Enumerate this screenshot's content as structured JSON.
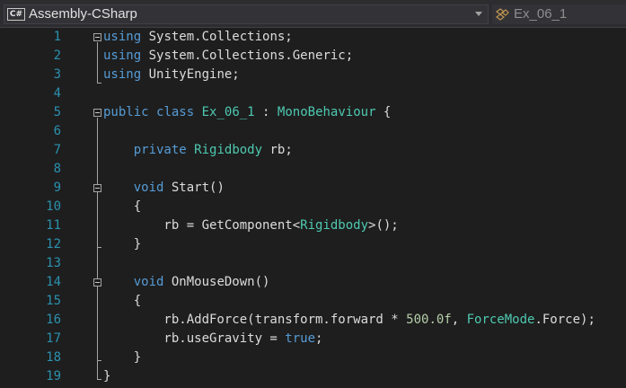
{
  "toolbar": {
    "project": "Assembly-CSharp",
    "project_icon": "C#",
    "member": "Ex_06_1",
    "member_icon": "class-icon"
  },
  "colors": {
    "background": "#1e1e1e",
    "line_number": "#2b91af",
    "keyword": "#569cd6",
    "type": "#4ec9b0",
    "number": "#b5cea8",
    "text": "#dcdcdc"
  },
  "lines": [
    {
      "n": "1",
      "tokens": [
        [
          "using",
          "kw"
        ],
        [
          " System.Collections;",
          ""
        ]
      ]
    },
    {
      "n": "2",
      "tokens": [
        [
          "using",
          "kw"
        ],
        [
          " System.Collections.Generic;",
          ""
        ]
      ]
    },
    {
      "n": "3",
      "tokens": [
        [
          "using",
          "kw"
        ],
        [
          " UnityEngine;",
          ""
        ]
      ]
    },
    {
      "n": "4",
      "tokens": []
    },
    {
      "n": "5",
      "tokens": [
        [
          "public",
          "kw"
        ],
        [
          " ",
          ""
        ],
        [
          "class",
          "kw"
        ],
        [
          " ",
          ""
        ],
        [
          "Ex_06_1",
          "ty"
        ],
        [
          " : ",
          ""
        ],
        [
          "MonoBehaviour",
          "ty"
        ],
        [
          " {",
          ""
        ]
      ]
    },
    {
      "n": "6",
      "tokens": []
    },
    {
      "n": "7",
      "tokens": [
        [
          "    ",
          ""
        ],
        [
          "private",
          "kw"
        ],
        [
          " ",
          ""
        ],
        [
          "Rigidbody",
          "ty"
        ],
        [
          " rb;",
          ""
        ]
      ]
    },
    {
      "n": "8",
      "tokens": []
    },
    {
      "n": "9",
      "tokens": [
        [
          "    ",
          ""
        ],
        [
          "void",
          "kw"
        ],
        [
          " Start()",
          ""
        ]
      ]
    },
    {
      "n": "10",
      "tokens": [
        [
          "    {",
          ""
        ]
      ]
    },
    {
      "n": "11",
      "tokens": [
        [
          "        rb = GetComponent<",
          ""
        ],
        [
          "Rigidbody",
          "ty"
        ],
        [
          ">();",
          ""
        ]
      ]
    },
    {
      "n": "12",
      "tokens": [
        [
          "    }",
          ""
        ]
      ]
    },
    {
      "n": "13",
      "tokens": []
    },
    {
      "n": "14",
      "tokens": [
        [
          "    ",
          ""
        ],
        [
          "void",
          "kw"
        ],
        [
          " OnMouseDown()",
          ""
        ]
      ]
    },
    {
      "n": "15",
      "tokens": [
        [
          "    {",
          ""
        ]
      ]
    },
    {
      "n": "16",
      "tokens": [
        [
          "        rb.AddForce(transform.forward * ",
          ""
        ],
        [
          "500.0f",
          "nm"
        ],
        [
          ", ",
          ""
        ],
        [
          "ForceMode",
          "ty"
        ],
        [
          ".Force);",
          ""
        ]
      ]
    },
    {
      "n": "17",
      "tokens": [
        [
          "        rb.useGravity = ",
          ""
        ],
        [
          "true",
          "kw"
        ],
        [
          ";",
          ""
        ]
      ]
    },
    {
      "n": "18",
      "tokens": [
        [
          "    }",
          ""
        ]
      ]
    },
    {
      "n": "19",
      "tokens": [
        [
          "}",
          ""
        ]
      ]
    }
  ]
}
